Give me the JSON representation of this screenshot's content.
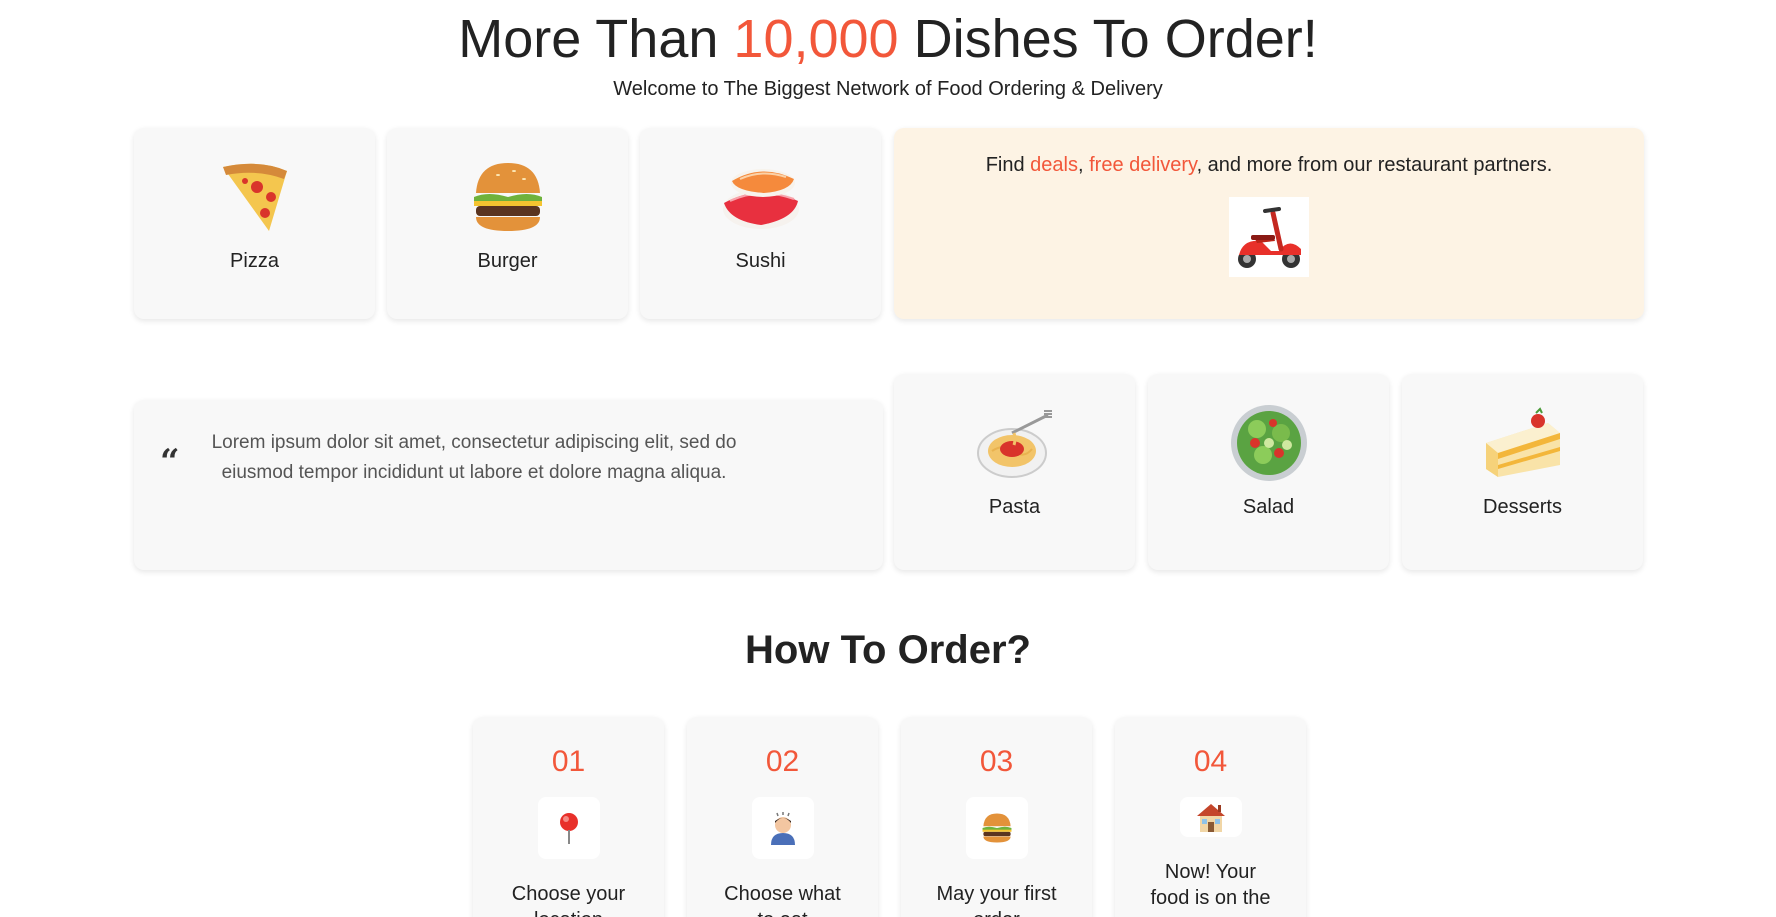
{
  "hero": {
    "title_before": "More Than ",
    "title_accent": "10,000",
    "title_after": " Dishes To Order!",
    "subtitle": "Welcome to The Biggest Network of Food Ordering & Delivery"
  },
  "categories_top": [
    {
      "label": "Pizza",
      "icon": "pizza-icon"
    },
    {
      "label": "Burger",
      "icon": "burger-icon"
    },
    {
      "label": "Sushi",
      "icon": "sushi-icon"
    }
  ],
  "promo": {
    "text_1": "Find ",
    "link_deals": "deals",
    "text_2": ", ",
    "link_free_delivery": "free delivery",
    "text_3": ", and more from our restaurant partners.",
    "icon": "scooter-icon"
  },
  "quote": {
    "mark": "“",
    "text": "Lorem ipsum dolor sit amet, consectetur adipiscing elit, sed do eiusmod tempor incididunt ut labore et dolore magna aliqua."
  },
  "categories_bottom": [
    {
      "label": "Pasta",
      "icon": "pasta-icon"
    },
    {
      "label": "Salad",
      "icon": "salad-icon"
    },
    {
      "label": "Desserts",
      "icon": "cake-icon"
    }
  ],
  "how_to_order": {
    "title": "How To Order?",
    "steps": [
      {
        "number": "01",
        "icon": "location-pin-icon",
        "text": "Choose your location"
      },
      {
        "number": "02",
        "icon": "thinking-person-icon",
        "text": "Choose what to eat"
      },
      {
        "number": "03",
        "icon": "burger-icon",
        "text": "May your first order"
      },
      {
        "number": "04",
        "icon": "house-icon",
        "text": "Now! Your food is on the way"
      }
    ]
  },
  "colors": {
    "accent": "#f2573a",
    "card_bg": "#f8f8f8",
    "promo_bg": "#fdf3e4"
  }
}
